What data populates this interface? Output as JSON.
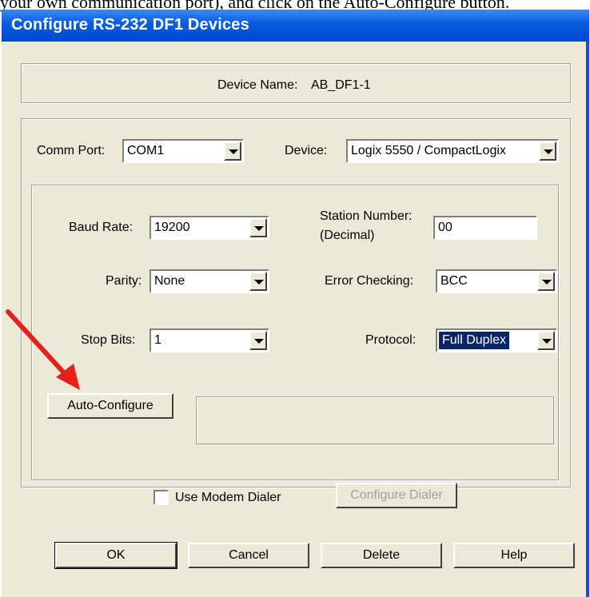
{
  "document": {
    "text_above": "your own communication port), and click on the Auto-Configure button."
  },
  "dialog": {
    "title": "Configure RS-232 DF1 Devices",
    "device_name_label": "Device Name:",
    "device_name_value": "AB_DF1-1",
    "comm_port": {
      "label": "Comm Port:",
      "value": "COM1"
    },
    "device": {
      "label": "Device:",
      "value": "Logix 5550 / CompactLogix"
    },
    "baud_rate": {
      "label": "Baud Rate:",
      "value": "19200"
    },
    "station_number": {
      "label_line1": "Station Number:",
      "label_line2": "(Decimal)",
      "value": "00"
    },
    "parity": {
      "label": "Parity:",
      "value": "None"
    },
    "error_checking": {
      "label": "Error Checking:",
      "value": "BCC"
    },
    "stop_bits": {
      "label": "Stop Bits:",
      "value": "1"
    },
    "protocol": {
      "label": "Protocol:",
      "value": "Full Duplex"
    },
    "auto_configure_label": "Auto-Configure",
    "use_modem_dialer_label": "Use Modem Dialer",
    "configure_dialer_label": "Configure Dialer",
    "buttons": {
      "ok": "OK",
      "cancel": "Cancel",
      "delete": "Delete",
      "help": "Help"
    }
  },
  "colors": {
    "annotation_arrow": "#e8201c",
    "titlebar": "#0a5fe0",
    "dialog_bg": "#ece9d8",
    "selection": "#0a246a"
  },
  "icons": [
    "dropdown-arrow-icon",
    "checkbox-icon",
    "annotation-arrow-icon"
  ]
}
